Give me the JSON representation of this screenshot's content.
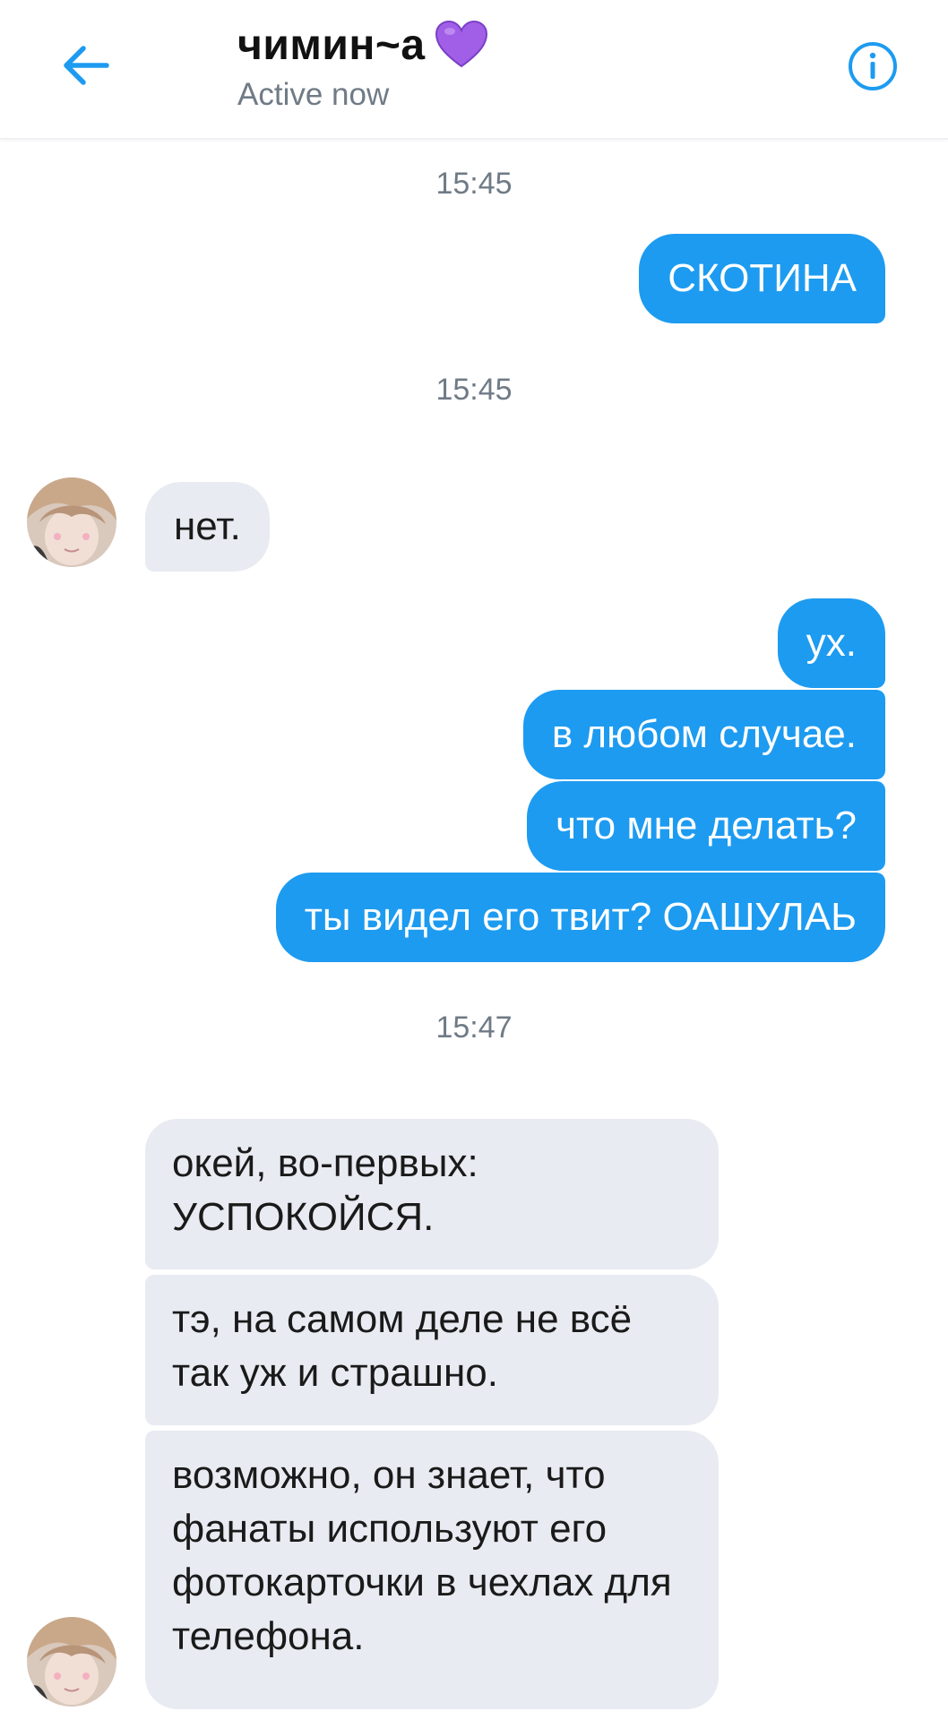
{
  "header": {
    "title": "чимин~а",
    "subtitle": "Active now",
    "back_icon": "arrow-left-icon",
    "heart_icon": "purple-heart-icon",
    "info_icon": "info-icon"
  },
  "colors": {
    "accent": "#1d9bf0",
    "outgoing_bubble": "#1d9bf0",
    "incoming_bubble": "#e8ebf1",
    "heart": "#a05fe6"
  },
  "timestamps": [
    "15:45",
    "15:45",
    "15:47"
  ],
  "messages": {
    "out1": "СКОТИНА",
    "in1": "нет.",
    "out2": "ух.",
    "out3": "в любом случае.",
    "out4": "что мне делать?",
    "out5": "ты видел его твит? ОАШУЛАЬ",
    "in2": "окей, во-первых: УСПОКОЙСЯ.",
    "in3": "тэ, на самом деле не всё так уж и страшно.",
    "in4": "возможно, он знает, что фанаты используют его фотокарточки в чехлах для телефона."
  }
}
